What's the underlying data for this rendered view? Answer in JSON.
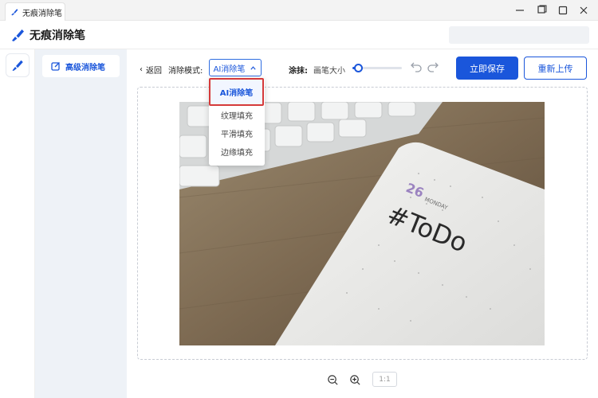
{
  "window": {
    "tab_title": "无痕消除笔",
    "minimize_label": "—",
    "maximize_label": "□",
    "close_label": "✕"
  },
  "app": {
    "brand_name": "无痕消除笔",
    "brand_color": "#1a56db"
  },
  "sidebar": {
    "items": [
      {
        "label": "高级消除笔",
        "icon": "edit-square-icon"
      }
    ]
  },
  "toolbar": {
    "back_label": "返回",
    "mode_label": "消除模式:",
    "mode_selected": "AI消除笔",
    "brush_label": "涂抹:",
    "brush_size_label": "画笔大小",
    "brush_size_fraction": 0.12,
    "save_label": "立即保存",
    "reupload_label": "重新上传"
  },
  "mode_options": [
    {
      "label": "AI消除笔",
      "selected": true
    },
    {
      "label": "纹理填充",
      "selected": false
    },
    {
      "label": "平滑填充",
      "selected": false
    },
    {
      "label": "边缘填充",
      "selected": false
    }
  ],
  "image": {
    "calendar_day": "26",
    "calendar_weekday": "MONDAY",
    "note_text": "#ToDo"
  },
  "zoom": {
    "ratio_label": "1:1"
  }
}
